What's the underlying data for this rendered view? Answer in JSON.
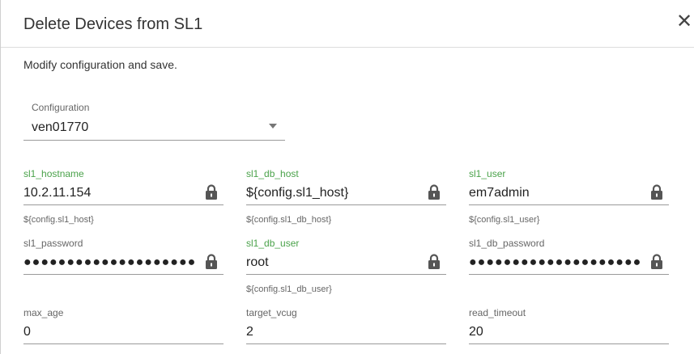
{
  "dialog": {
    "title": "Delete Devices from SL1",
    "close_icon": "close-icon",
    "subtitle": "Modify configuration and save."
  },
  "configuration": {
    "label": "Configuration",
    "value": "ven01770"
  },
  "fields": {
    "sl1_hostname": {
      "label": "sl1_hostname",
      "value": "10.2.11.154",
      "hint": "${config.sl1_host}"
    },
    "sl1_db_host": {
      "label": "sl1_db_host",
      "value": "${config.sl1_host}",
      "hint": "${config.sl1_db_host}"
    },
    "sl1_user": {
      "label": "sl1_user",
      "value": "em7admin",
      "hint": "${config.sl1_user}"
    },
    "sl1_password": {
      "label": "sl1_password",
      "value": "●●●●●●●●●●●●●●●●●●●●"
    },
    "sl1_db_user": {
      "label": "sl1_db_user",
      "value": "root",
      "hint": "${config.sl1_db_user}"
    },
    "sl1_db_password": {
      "label": "sl1_db_password",
      "value": "●●●●●●●●●●●●●●●●●●●●"
    },
    "max_age": {
      "label": "max_age",
      "value": "0"
    },
    "target_vcug": {
      "label": "target_vcug",
      "value": "2"
    },
    "read_timeout": {
      "label": "read_timeout",
      "value": "20"
    }
  },
  "colors": {
    "modified_label": "#4aa24a",
    "default_label": "#666666",
    "lock_icon": "#555555"
  },
  "icons": {
    "lock": "lock-icon",
    "dropdown": "chevron-down-icon"
  }
}
